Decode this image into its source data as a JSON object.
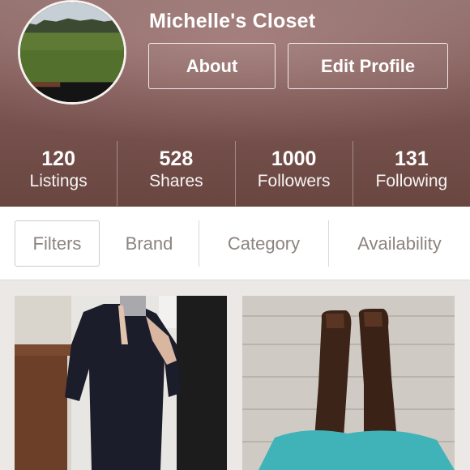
{
  "profile": {
    "closet_name": "Michelle's Closet",
    "avatar_icon": "profile-photo-field-landscape"
  },
  "header_buttons": {
    "about_label": "About",
    "edit_profile_label": "Edit Profile"
  },
  "stats": [
    {
      "value": "120",
      "label": "Listings"
    },
    {
      "value": "528",
      "label": "Shares"
    },
    {
      "value": "1000",
      "label": "Followers"
    },
    {
      "value": "131",
      "label": "Following"
    }
  ],
  "filter_bar": {
    "filters_label": "Filters",
    "tabs": [
      "Brand",
      "Category",
      "Availability"
    ]
  },
  "listings": [
    {
      "image_icon": "listing-photo-black-shirt-dress"
    },
    {
      "image_icon": "listing-photo-brown-leather-boots"
    }
  ],
  "colors": {
    "header_bg": "#7a5551",
    "filter_text": "#8c8480",
    "grid_bg": "#ebe8e5"
  }
}
